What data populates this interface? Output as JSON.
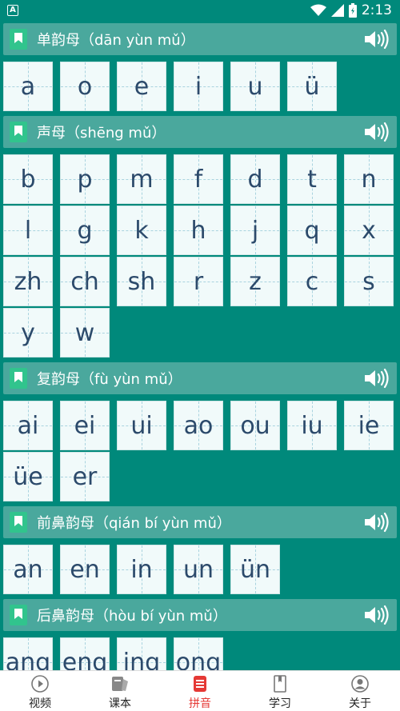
{
  "status_bar": {
    "time": "2:13",
    "app_badge": "A"
  },
  "sections": [
    {
      "title": "单韵母（dān yùn mǔ）",
      "items": [
        "a",
        "o",
        "e",
        "i",
        "u",
        "ü"
      ]
    },
    {
      "title": "声母（shēng mǔ）",
      "items": [
        "b",
        "p",
        "m",
        "f",
        "d",
        "t",
        "n",
        "l",
        "g",
        "k",
        "h",
        "j",
        "q",
        "x",
        "zh",
        "ch",
        "sh",
        "r",
        "z",
        "c",
        "s",
        "y",
        "w"
      ]
    },
    {
      "title": "复韵母（fù yùn mǔ）",
      "items": [
        "ai",
        "ei",
        "ui",
        "ao",
        "ou",
        "iu",
        "ie",
        "üe",
        "er"
      ]
    },
    {
      "title": "前鼻韵母（qián bí yùn mǔ）",
      "items": [
        "an",
        "en",
        "in",
        "un",
        "ün"
      ]
    },
    {
      "title": "后鼻韵母（hòu bí yùn mǔ）",
      "items": [
        "ang",
        "eng",
        "ing",
        "ong"
      ]
    }
  ],
  "bottom_nav": [
    {
      "label": "视频",
      "icon": "play-icon",
      "active": false
    },
    {
      "label": "课本",
      "icon": "textbook-icon",
      "active": false
    },
    {
      "label": "拼音",
      "icon": "pinyin-icon",
      "active": true
    },
    {
      "label": "学习",
      "icon": "bookmark-icon",
      "active": false
    },
    {
      "label": "关于",
      "icon": "user-icon",
      "active": false
    }
  ],
  "colors": {
    "background": "#00897b",
    "header": "#4aa89d",
    "card": "#f1fafa",
    "text": "#2c4a6b",
    "active": "#e53935"
  }
}
